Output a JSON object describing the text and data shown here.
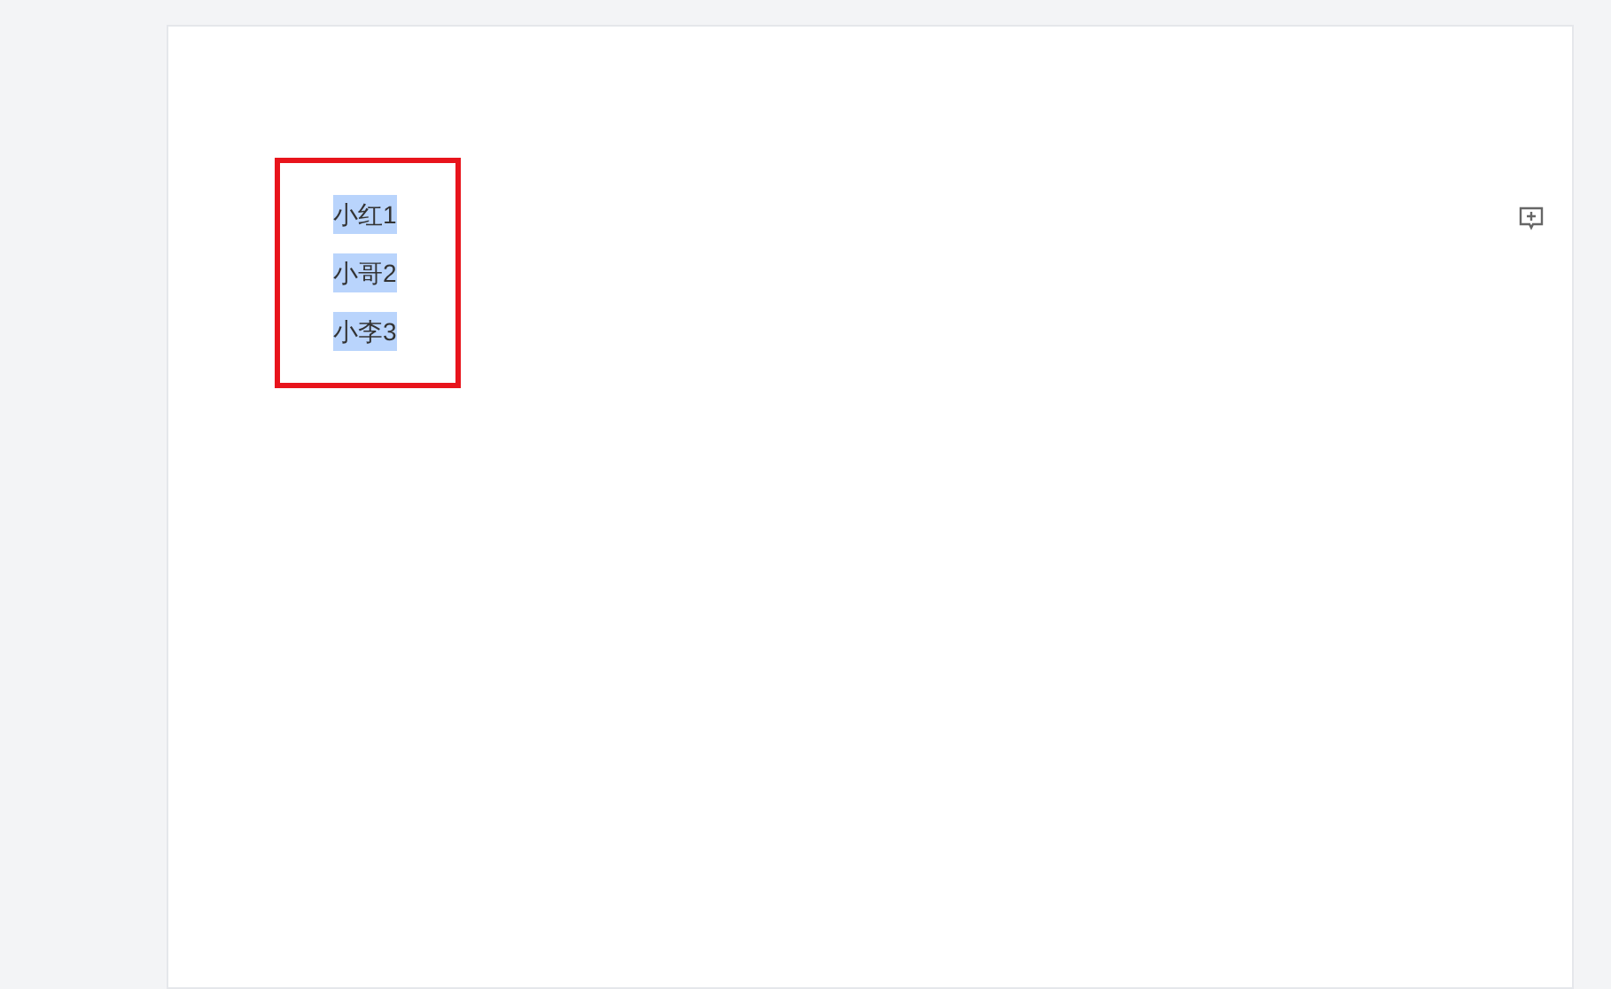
{
  "document": {
    "lines": [
      {
        "text": "小红1",
        "selected": true
      },
      {
        "text": "小哥2",
        "selected": true
      },
      {
        "text": "小李3",
        "selected": true
      }
    ]
  }
}
